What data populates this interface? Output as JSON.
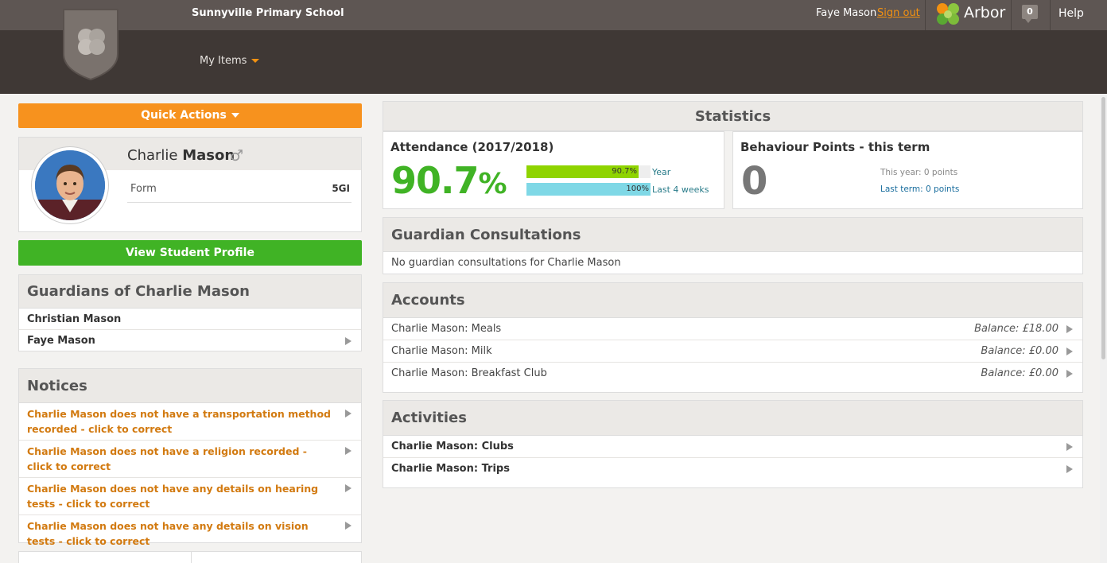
{
  "header": {
    "school_name": "Sunnyville Primary School",
    "my_items": "My Items",
    "user_name": "Faye Mason",
    "sign_out": "Sign out",
    "brand": "Arbor",
    "notification_count": "0",
    "help": "Help"
  },
  "left": {
    "quick_actions": "Quick Actions",
    "student": {
      "first_name": "Charlie",
      "last_name": "Mason",
      "gender_icon": "male-icon",
      "form_label": "Form",
      "form_value": "5GI"
    },
    "view_profile": "View Student Profile",
    "guardians": {
      "title": "Guardians of Charlie Mason",
      "items": [
        {
          "name": "Christian Mason"
        },
        {
          "name": "Faye Mason"
        }
      ]
    },
    "notices": {
      "title": "Notices",
      "items": [
        {
          "text": "Charlie Mason does not have a transportation method recorded - click to correct"
        },
        {
          "text": "Charlie Mason does not have a religion recorded - click to correct"
        },
        {
          "text": "Charlie Mason does not have any details on hearing tests - click to correct"
        },
        {
          "text": "Charlie Mason does not have any details on vision tests - click to correct"
        }
      ]
    }
  },
  "statistics": {
    "title": "Statistics",
    "attendance": {
      "title": "Attendance (2017/2018)",
      "value": "90.7",
      "unit": "%",
      "year_value": 0.907,
      "year_label_value": "90.7%",
      "year_label": "Year",
      "recent_value": 1.0,
      "recent_label_value": "100%",
      "recent_label": "Last 4 weeks"
    },
    "behaviour": {
      "title": "Behaviour Points - this term",
      "value": "0",
      "this_year": "This year: 0 points",
      "last_term": "Last term: 0 points"
    }
  },
  "consultations": {
    "title": "Guardian Consultations",
    "empty": "No guardian consultations for Charlie Mason"
  },
  "accounts": {
    "title": "Accounts",
    "items": [
      {
        "name": "Charlie Mason: Meals",
        "balance": "Balance: £18.00"
      },
      {
        "name": "Charlie Mason: Milk",
        "balance": "Balance: £0.00"
      },
      {
        "name": "Charlie Mason: Breakfast Club",
        "balance": "Balance: £0.00"
      }
    ]
  },
  "activities": {
    "title": "Activities",
    "items": [
      {
        "name": "Charlie Mason: Clubs"
      },
      {
        "name": "Charlie Mason: Trips"
      }
    ]
  },
  "colors": {
    "accent_orange": "#f7921e",
    "green": "#40b325",
    "bar_year": "#8fd400",
    "bar_recent": "#7fd8e6"
  }
}
